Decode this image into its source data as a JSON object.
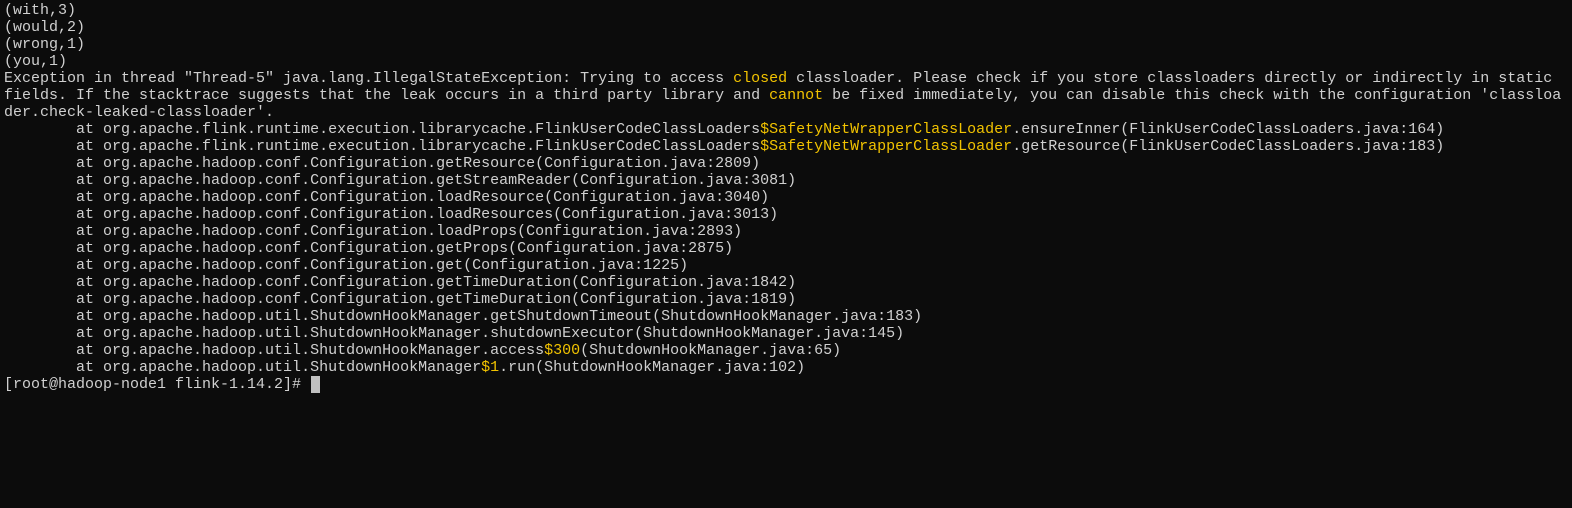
{
  "output_pairs": [
    "(with,3)",
    "(would,2)",
    "(wrong,1)",
    "(you,1)"
  ],
  "exception": {
    "header_parts": [
      {
        "text": "Exception in thread \"Thread-5\" java.lang.IllegalStateException: Trying to access ",
        "cls": "gray"
      },
      {
        "text": "closed",
        "cls": "yellow"
      },
      {
        "text": " classloader. Please check if you store classloaders directly or indirectly in static fields. If the stacktrace suggests that the leak occurs in a third party library and ",
        "cls": "gray"
      },
      {
        "text": "cannot",
        "cls": "yellow"
      },
      {
        "text": " be fixed immediately, you can disable this check with the configuration 'classloader.check-leaked-classloader'.",
        "cls": "gray"
      }
    ],
    "stack": [
      {
        "indent": "        at ",
        "parts": [
          {
            "text": "org.apache.flink.runtime.execution.librarycache.FlinkUserCodeClassLoaders",
            "cls": "gray"
          },
          {
            "text": "$SafetyNetWrapperClassLoader",
            "cls": "yellow"
          },
          {
            "text": ".ensureInner(FlinkUserCodeClassLoaders.java:164)",
            "cls": "gray"
          }
        ]
      },
      {
        "indent": "        at ",
        "parts": [
          {
            "text": "org.apache.flink.runtime.execution.librarycache.FlinkUserCodeClassLoaders",
            "cls": "gray"
          },
          {
            "text": "$SafetyNetWrapperClassLoader",
            "cls": "yellow"
          },
          {
            "text": ".getResource(FlinkUserCodeClassLoaders.java:183)",
            "cls": "gray"
          }
        ]
      },
      {
        "indent": "        at ",
        "parts": [
          {
            "text": "org.apache.hadoop.conf.Configuration.getResource(Configuration.java:2809)",
            "cls": "gray"
          }
        ]
      },
      {
        "indent": "        at ",
        "parts": [
          {
            "text": "org.apache.hadoop.conf.Configuration.getStreamReader(Configuration.java:3081)",
            "cls": "gray"
          }
        ]
      },
      {
        "indent": "        at ",
        "parts": [
          {
            "text": "org.apache.hadoop.conf.Configuration.loadResource(Configuration.java:3040)",
            "cls": "gray"
          }
        ]
      },
      {
        "indent": "        at ",
        "parts": [
          {
            "text": "org.apache.hadoop.conf.Configuration.loadResources(Configuration.java:3013)",
            "cls": "gray"
          }
        ]
      },
      {
        "indent": "        at ",
        "parts": [
          {
            "text": "org.apache.hadoop.conf.Configuration.loadProps(Configuration.java:2893)",
            "cls": "gray"
          }
        ]
      },
      {
        "indent": "        at ",
        "parts": [
          {
            "text": "org.apache.hadoop.conf.Configuration.getProps(Configuration.java:2875)",
            "cls": "gray"
          }
        ]
      },
      {
        "indent": "        at ",
        "parts": [
          {
            "text": "org.apache.hadoop.conf.Configuration.get(Configuration.java:1225)",
            "cls": "gray"
          }
        ]
      },
      {
        "indent": "        at ",
        "parts": [
          {
            "text": "org.apache.hadoop.conf.Configuration.getTimeDuration(Configuration.java:1842)",
            "cls": "gray"
          }
        ]
      },
      {
        "indent": "        at ",
        "parts": [
          {
            "text": "org.apache.hadoop.conf.Configuration.getTimeDuration(Configuration.java:1819)",
            "cls": "gray"
          }
        ]
      },
      {
        "indent": "        at ",
        "parts": [
          {
            "text": "org.apache.hadoop.util.ShutdownHookManager.getShutdownTimeout(ShutdownHookManager.java:183)",
            "cls": "gray"
          }
        ]
      },
      {
        "indent": "        at ",
        "parts": [
          {
            "text": "org.apache.hadoop.util.ShutdownHookManager.shutdownExecutor(ShutdownHookManager.java:145)",
            "cls": "gray"
          }
        ]
      },
      {
        "indent": "        at ",
        "parts": [
          {
            "text": "org.apache.hadoop.util.ShutdownHookManager.access",
            "cls": "gray"
          },
          {
            "text": "$300",
            "cls": "yellow"
          },
          {
            "text": "(ShutdownHookManager.java:65)",
            "cls": "gray"
          }
        ]
      },
      {
        "indent": "        at ",
        "parts": [
          {
            "text": "org.apache.hadoop.util.ShutdownHookManager",
            "cls": "gray"
          },
          {
            "text": "$1",
            "cls": "yellow"
          },
          {
            "text": ".run(ShutdownHookManager.java:102)",
            "cls": "gray"
          }
        ]
      }
    ]
  },
  "prompt": "[root@hadoop-node1 flink-1.14.2]# "
}
